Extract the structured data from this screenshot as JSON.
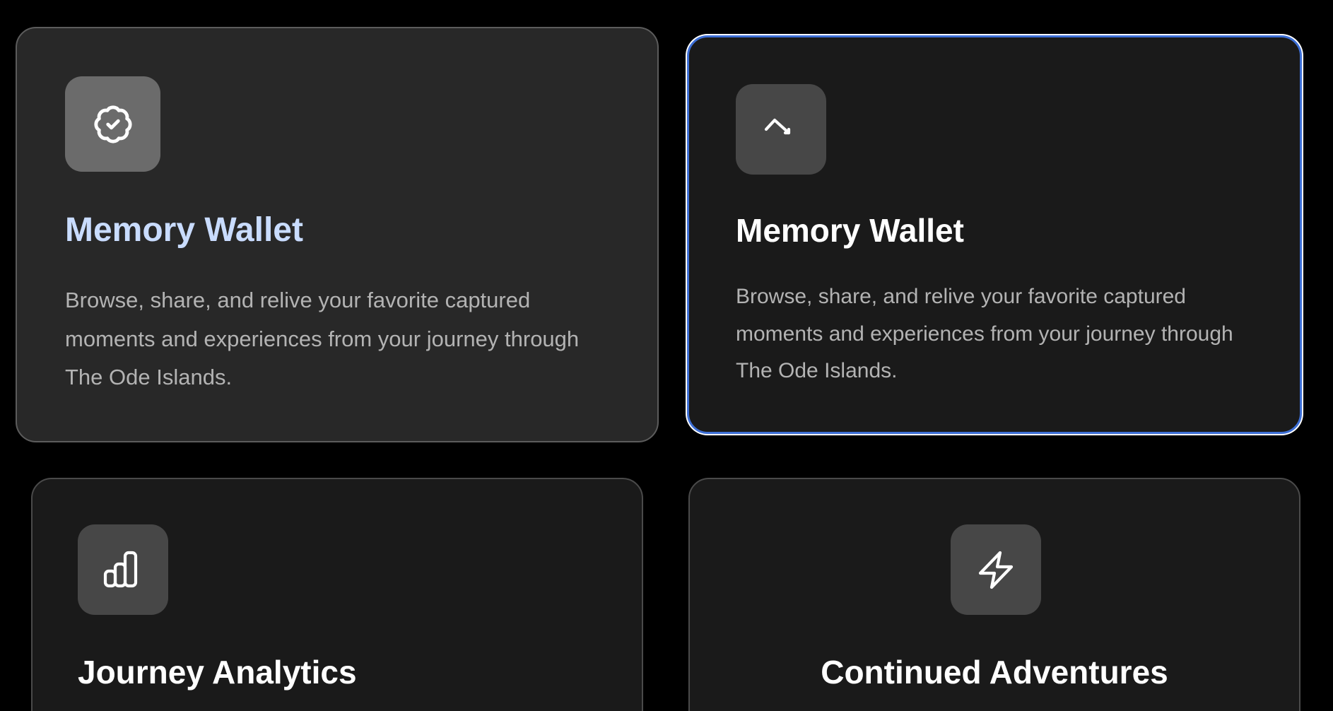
{
  "cards": [
    {
      "title": "Memory Wallet",
      "description": "Browse, share, and relive your favorite captured moments and experiences from your journey through The Ode Islands.",
      "icon": "badge-check-icon",
      "state": "hovered",
      "title_color": "#c9dcff"
    },
    {
      "title": "Memory Wallet",
      "description": "Browse, share, and relive your favorite captured moments and experiences from your journey through The Ode Islands.",
      "icon": "arrow-icon",
      "state": "focused",
      "focus_ring_color": "#3d6fd6"
    },
    {
      "title": "Journey Analytics",
      "icon": "bar-chart-icon"
    },
    {
      "title": "Continued Adventures",
      "icon": "lightning-icon"
    }
  ]
}
